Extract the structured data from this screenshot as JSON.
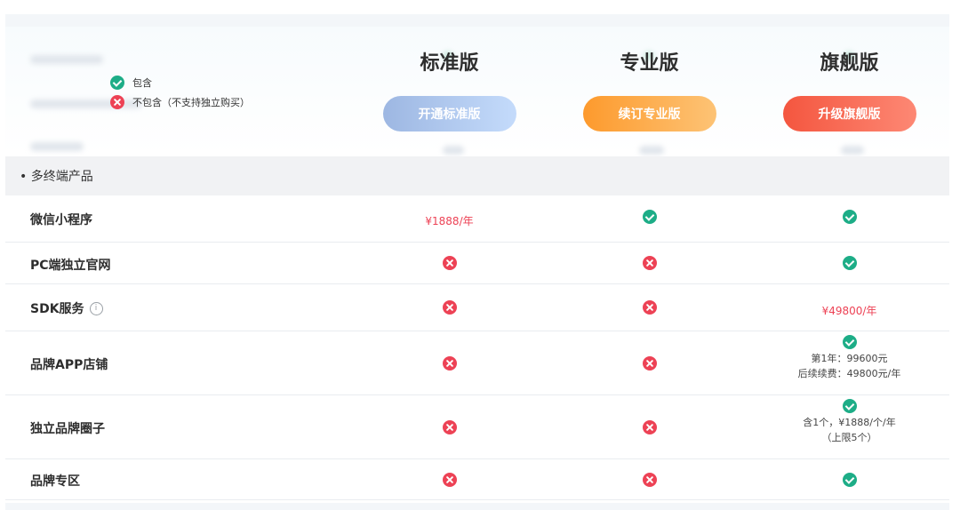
{
  "legend": {
    "included": "包含",
    "not_included": "不包含（不支持独立购买）"
  },
  "plans": [
    {
      "name": "标准版",
      "button": "开通标准版"
    },
    {
      "name": "专业版",
      "button": "续订专业版"
    },
    {
      "name": "旗舰版",
      "button": "升级旗舰版"
    }
  ],
  "section": {
    "title": "• 多终端产品"
  },
  "features": [
    {
      "label": "微信小程序",
      "cells": [
        {
          "type": "price",
          "text": "¥1888/年"
        },
        {
          "type": "ok"
        },
        {
          "type": "ok"
        }
      ]
    },
    {
      "label": "PC端独立官网",
      "cells": [
        {
          "type": "no"
        },
        {
          "type": "no"
        },
        {
          "type": "ok"
        }
      ]
    },
    {
      "label": "SDK服务",
      "has_info": true,
      "info_glyph": "i",
      "cells": [
        {
          "type": "no"
        },
        {
          "type": "no"
        },
        {
          "type": "price",
          "text": "¥49800/年"
        }
      ]
    },
    {
      "label": "品牌APP店铺",
      "cells": [
        {
          "type": "no"
        },
        {
          "type": "no"
        },
        {
          "type": "ok_note",
          "lines": [
            "第1年：99600元",
            "后续续费：49800元/年"
          ]
        }
      ]
    },
    {
      "label": "独立品牌圈子",
      "cells": [
        {
          "type": "no"
        },
        {
          "type": "no"
        },
        {
          "type": "ok_note",
          "lines": [
            "含1个，¥1888/个/年",
            "（上限5个）"
          ]
        }
      ]
    },
    {
      "label": "品牌专区",
      "cells": [
        {
          "type": "no"
        },
        {
          "type": "no"
        },
        {
          "type": "ok"
        }
      ]
    }
  ],
  "colors": {
    "included": "#1dad87",
    "not_included": "#ed4255",
    "price": "#ed4255"
  }
}
